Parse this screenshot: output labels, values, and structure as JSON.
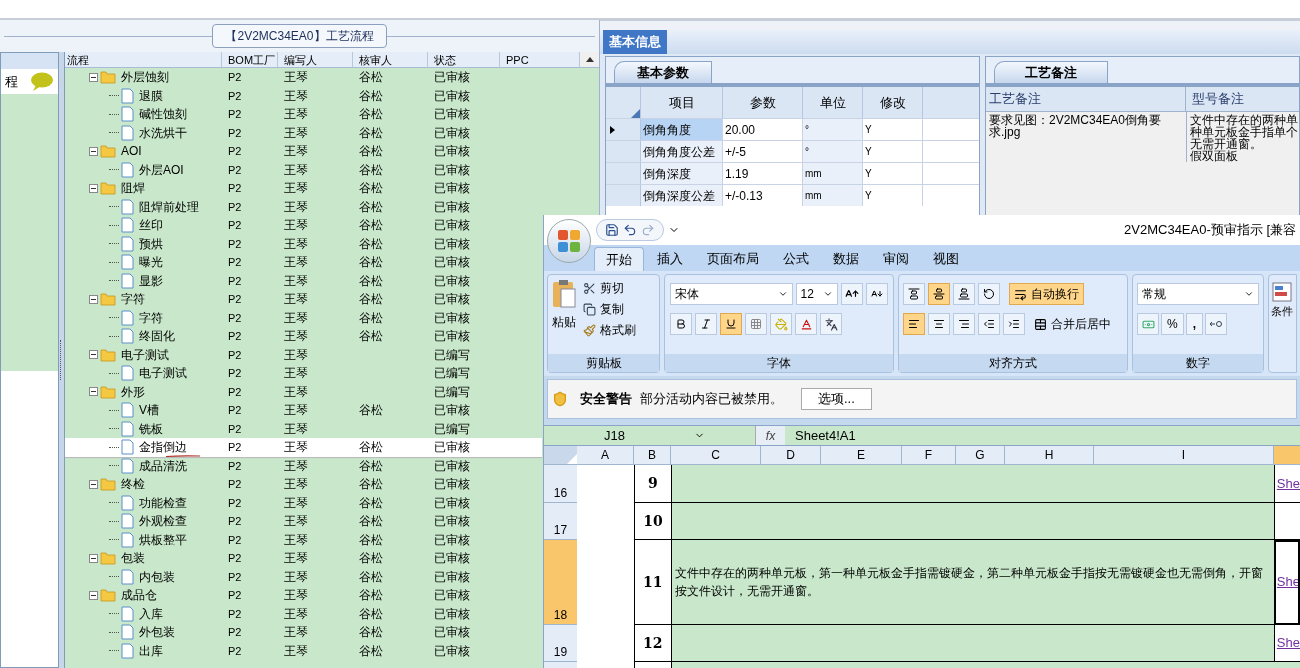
{
  "process_panel": {
    "title": "【2V2MC34EA0】工艺流程",
    "side_label": "程",
    "columns": [
      "流程",
      "BOM工厂",
      "编写人",
      "核审人",
      "状态",
      "PPC"
    ],
    "tree": [
      {
        "name": "外层蚀刻",
        "bom": "P2",
        "writer": "王琴",
        "reviewer": "谷松",
        "status": "已审核",
        "expanded": true,
        "selected": false,
        "children": [
          {
            "name": "退膜",
            "bom": "P2",
            "writer": "王琴",
            "reviewer": "谷松",
            "status": "已审核",
            "selected": false
          },
          {
            "name": "碱性蚀刻",
            "bom": "P2",
            "writer": "王琴",
            "reviewer": "谷松",
            "status": "已审核",
            "selected": false
          },
          {
            "name": "水洗烘干",
            "bom": "P2",
            "writer": "王琴",
            "reviewer": "谷松",
            "status": "已审核",
            "selected": false
          }
        ]
      },
      {
        "name": "AOI",
        "bom": "P2",
        "writer": "王琴",
        "reviewer": "谷松",
        "status": "已审核",
        "expanded": true,
        "selected": false,
        "children": [
          {
            "name": "外层AOI",
            "bom": "P2",
            "writer": "王琴",
            "reviewer": "谷松",
            "status": "已审核",
            "selected": false
          }
        ]
      },
      {
        "name": "阻焊",
        "bom": "P2",
        "writer": "王琴",
        "reviewer": "谷松",
        "status": "已审核",
        "expanded": true,
        "selected": false,
        "children": [
          {
            "name": "阻焊前处理",
            "bom": "P2",
            "writer": "王琴",
            "reviewer": "谷松",
            "status": "已审核",
            "selected": false
          },
          {
            "name": "丝印",
            "bom": "P2",
            "writer": "王琴",
            "reviewer": "谷松",
            "status": "已审核",
            "selected": false
          },
          {
            "name": "预烘",
            "bom": "P2",
            "writer": "王琴",
            "reviewer": "谷松",
            "status": "已审核",
            "selected": false
          },
          {
            "name": "曝光",
            "bom": "P2",
            "writer": "王琴",
            "reviewer": "谷松",
            "status": "已审核",
            "selected": false
          },
          {
            "name": "显影",
            "bom": "P2",
            "writer": "王琴",
            "reviewer": "谷松",
            "status": "已审核",
            "selected": false
          }
        ]
      },
      {
        "name": "字符",
        "bom": "P2",
        "writer": "王琴",
        "reviewer": "谷松",
        "status": "已审核",
        "expanded": true,
        "selected": false,
        "children": [
          {
            "name": "字符",
            "bom": "P2",
            "writer": "王琴",
            "reviewer": "谷松",
            "status": "已审核",
            "selected": false
          },
          {
            "name": "终固化",
            "bom": "P2",
            "writer": "王琴",
            "reviewer": "谷松",
            "status": "已审核",
            "selected": false
          }
        ]
      },
      {
        "name": "电子测试",
        "bom": "P2",
        "writer": "王琴",
        "status": "已编写",
        "expanded": true,
        "selected": false,
        "children": [
          {
            "name": "电子测试",
            "bom": "P2",
            "writer": "王琴",
            "status": "已编写",
            "selected": false
          }
        ]
      },
      {
        "name": "外形",
        "bom": "P2",
        "writer": "王琴",
        "status": "已编写",
        "expanded": true,
        "selected": false,
        "children": [
          {
            "name": "V槽",
            "bom": "P2",
            "writer": "王琴",
            "reviewer": "谷松",
            "status": "已审核",
            "selected": false
          },
          {
            "name": "铣板",
            "bom": "P2",
            "writer": "王琴",
            "status": "已编写",
            "selected": false
          },
          {
            "name": "金指倒边",
            "bom": "P2",
            "writer": "王琴",
            "reviewer": "谷松",
            "status": "已审核",
            "selected": true
          },
          {
            "name": "成品清洗",
            "bom": "P2",
            "writer": "王琴",
            "reviewer": "谷松",
            "status": "已审核",
            "selected": false
          }
        ]
      },
      {
        "name": "终检",
        "bom": "P2",
        "writer": "王琴",
        "reviewer": "谷松",
        "status": "已审核",
        "expanded": true,
        "selected": false,
        "children": [
          {
            "name": "功能检查",
            "bom": "P2",
            "writer": "王琴",
            "reviewer": "谷松",
            "status": "已审核",
            "selected": false
          },
          {
            "name": "外观检查",
            "bom": "P2",
            "writer": "王琴",
            "reviewer": "谷松",
            "status": "已审核",
            "selected": false
          },
          {
            "name": "烘板整平",
            "bom": "P2",
            "writer": "王琴",
            "reviewer": "谷松",
            "status": "已审核",
            "selected": false
          }
        ]
      },
      {
        "name": "包装",
        "bom": "P2",
        "writer": "王琴",
        "reviewer": "谷松",
        "status": "已审核",
        "expanded": true,
        "selected": false,
        "children": [
          {
            "name": "内包装",
            "bom": "P2",
            "writer": "王琴",
            "reviewer": "谷松",
            "status": "已审核",
            "selected": false
          }
        ]
      },
      {
        "name": "成品仓",
        "bom": "P2",
        "writer": "王琴",
        "reviewer": "谷松",
        "status": "已审核",
        "expanded": true,
        "selected": false,
        "children": [
          {
            "name": "入库",
            "bom": "P2",
            "writer": "王琴",
            "reviewer": "谷松",
            "status": "已审核",
            "selected": false
          },
          {
            "name": "外包装",
            "bom": "P2",
            "writer": "王琴",
            "reviewer": "谷松",
            "status": "已审核",
            "selected": false
          },
          {
            "name": "出库",
            "bom": "P2",
            "writer": "王琴",
            "reviewer": "谷松",
            "status": "已审核",
            "selected": false
          }
        ]
      }
    ]
  },
  "info_panel": {
    "tab": {
      "label": "基本信息",
      "selected": true
    },
    "params": {
      "tab": "基本参数",
      "columns": [
        "项目",
        "参数",
        "单位",
        "修改"
      ],
      "rows": [
        {
          "item": "倒角角度",
          "value": "20.00",
          "unit": "°",
          "modified": "Y",
          "current": true
        },
        {
          "item": "倒角角度公差",
          "value": "+/-5",
          "unit": "°",
          "modified": "Y",
          "current": false
        },
        {
          "item": "倒角深度",
          "value": "1.19",
          "unit": "mm",
          "modified": "Y",
          "current": false
        },
        {
          "item": "倒角深度公差",
          "value": "+/-0.13",
          "unit": "mm",
          "modified": "Y",
          "current": false
        }
      ]
    },
    "notes": {
      "tab": "工艺备注",
      "columns": [
        "工艺备注",
        "型号备注"
      ],
      "process_note": "要求见图：2V2MC34EA0倒角要求.jpg",
      "model_note_lines": [
        "文件中存在的两种单",
        "种单元板金手指单个",
        "无需开通窗。",
        "假双面板"
      ]
    }
  },
  "excel_window": {
    "title": "2V2MC34EA0-预审指示  [兼容",
    "ribbon_tabs": [
      {
        "label": "开始",
        "selected": true
      },
      {
        "label": "插入",
        "selected": false
      },
      {
        "label": "页面布局",
        "selected": false
      },
      {
        "label": "公式",
        "selected": false
      },
      {
        "label": "数据",
        "selected": false
      },
      {
        "label": "审阅",
        "selected": false
      },
      {
        "label": "视图",
        "selected": false
      }
    ],
    "clipboard": {
      "paste": "粘贴",
      "cut": "剪切",
      "copy": "复制",
      "painter": "格式刷",
      "group": "剪贴板"
    },
    "font": {
      "name": "宋体",
      "size": "12",
      "bold": false,
      "italic": false,
      "underline": true,
      "group": "字体"
    },
    "alignment": {
      "vertical_middle": true,
      "left": true,
      "wrap": {
        "label": "自动换行",
        "on": true
      },
      "merge": "合并后居中",
      "group": "对齐方式"
    },
    "number": {
      "format": "常规",
      "percent": "%",
      "comma": ",",
      "group": "数字"
    },
    "styles": {
      "conditional": "条件"
    },
    "security_bar": {
      "title": "安全警告",
      "message": "部分活动内容已被禁用。",
      "button": "选项..."
    },
    "formula_bar": {
      "cell": "J18",
      "fx_label": "fx",
      "formula": "Sheet4!A1"
    },
    "sheet": {
      "columns": [
        "A",
        "B",
        "C",
        "D",
        "E",
        "F",
        "G",
        "H",
        "I"
      ],
      "rows": [
        {
          "header": "16",
          "number": "9",
          "link": "She",
          "selected": false
        },
        {
          "header": "17",
          "number": "10",
          "selected": false
        },
        {
          "header": "18",
          "number": "11",
          "text": "文件中存在的两种单元板，第一种单元板金手指需镀硬金，第二种单元板金手指按无需镀硬金也无需倒角，开窗按文件设计，无需开通窗。",
          "link": "She",
          "selected": true
        },
        {
          "header": "19",
          "number": "12",
          "link": "She",
          "selected": false
        }
      ]
    }
  }
}
